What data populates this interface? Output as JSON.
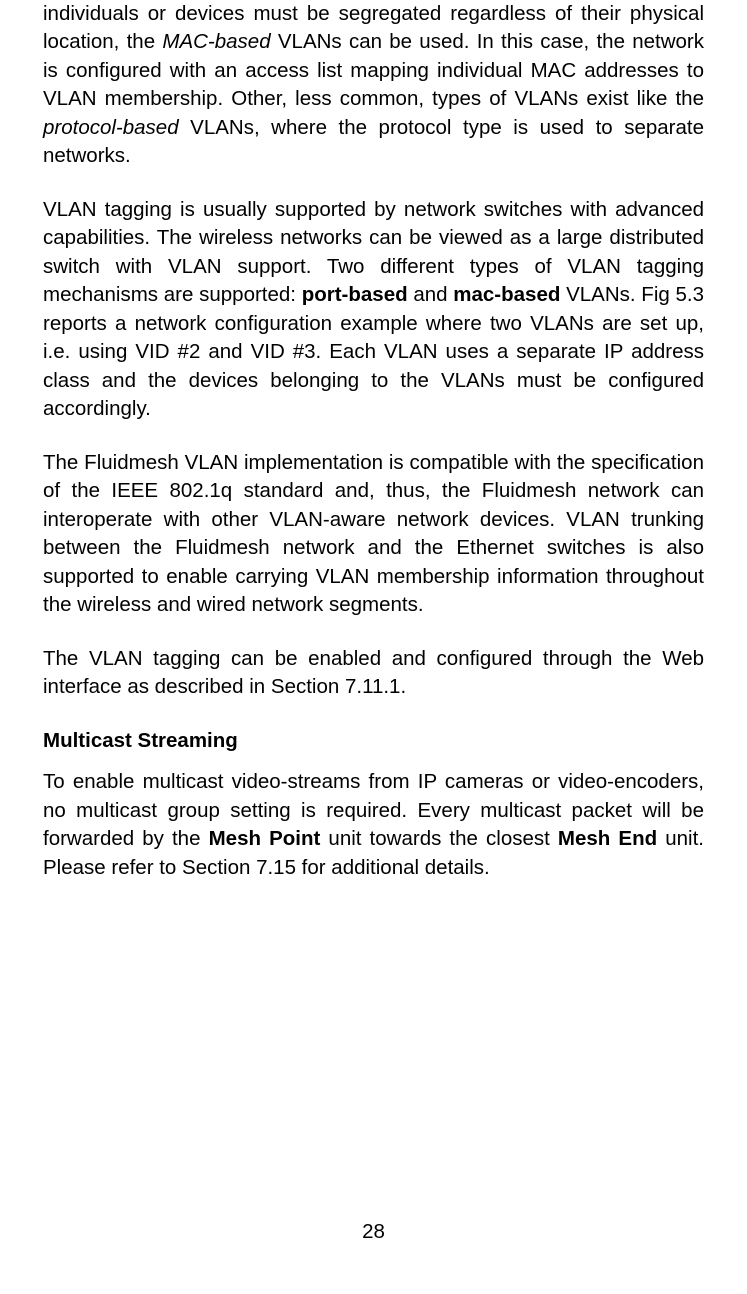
{
  "paragraphs": {
    "p1_part1": "individuals or devices must be segregated regardless of their physical location, the ",
    "p1_italic1": "MAC-based",
    "p1_part2": " VLANs can be used. In this case, the network is configured with an access list mapping individual MAC addresses to VLAN membership. Other, less common, types of VLANs exist like the ",
    "p1_italic2": "protocol-based",
    "p1_part3": " VLANs, where the protocol type is used to separate networks.",
    "p2_part1": "VLAN tagging is usually supported by network switches with advanced capabilities. The wireless networks can be viewed as a large distributed switch with VLAN support. Two different types of VLAN tagging mechanisms are supported: ",
    "p2_bold1": "port-based",
    "p2_part2": " and ",
    "p2_bold2": "mac-based",
    "p2_part3": " VLANs. Fig 5.3 reports a network configuration example where two VLANs are set up, i.e. using VID #2 and VID #3. Each VLAN uses a separate IP address class and the devices belonging to the VLANs must be configured accordingly.",
    "p3": "The Fluidmesh VLAN implementation is compatible with the specification of the IEEE 802.1q standard and, thus, the Fluidmesh network can interoperate with other VLAN-aware network devices. VLAN trunking between the Fluidmesh network and the Ethernet switches is also supported to enable carrying VLAN membership information throughout the wireless and wired network segments.",
    "p4": "The VLAN tagging can be enabled and configured through the Web interface as described in Section 7.11.1.",
    "heading": "Multicast Streaming",
    "p5_part1": "To enable multicast video-streams from IP cameras or video-encoders, no multicast group setting is required. Every multicast packet will be forwarded by the ",
    "p5_bold1": "Mesh Point",
    "p5_part2": " unit towards the closest ",
    "p5_bold2": "Mesh End",
    "p5_part3": " unit. Please refer to Section 7.15 for additional details."
  },
  "page_number": "28"
}
